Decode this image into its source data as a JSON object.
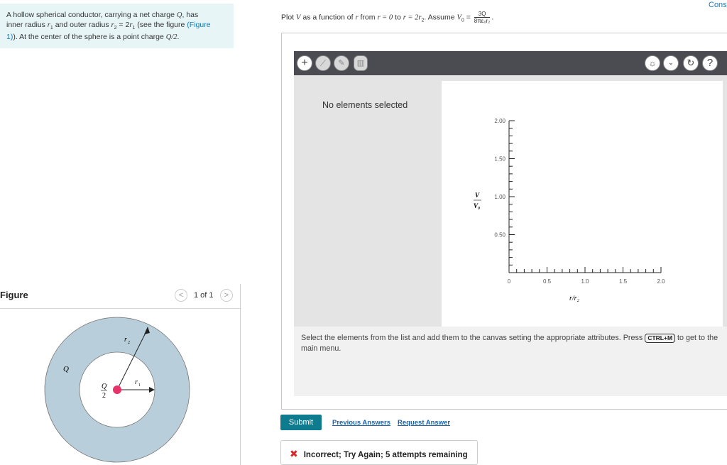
{
  "problem": {
    "line1a": "A hollow spherical conductor, carrying a net charge ",
    "line1_charge": "Q",
    "line1b": ", has",
    "line2a": "inner radius ",
    "line2_r1": "r",
    "line2b": " and outer radius ",
    "line2_r2": "r",
    "line2_eq": " = 2",
    "line2_r1b": "r",
    "line2c": " (see the figure ",
    "figure_link": "(Figure",
    "line3_link": "1)",
    "line3a": "). At the center of the sphere is a point charge ",
    "line3_charge": "Q/2",
    "line3b": "."
  },
  "figure": {
    "title": "Figure",
    "counter": "1 of 1",
    "label_Q": "Q",
    "label_r2": "r",
    "label_r2_sub": "2",
    "label_r1": "r",
    "label_r1_sub": "1",
    "label_q_num": "Q",
    "label_q_den": "2"
  },
  "question": {
    "prefix": "Plot ",
    "V": "V",
    "mid1": " as a function of ",
    "r": "r",
    "mid2": " from ",
    "range1": "r = 0",
    "to": " to ",
    "range2": "r = 2r",
    "range2_sub": "2",
    "assume": ". Assume ",
    "V0": "V",
    "V0_sub": "0",
    "eq": " = ",
    "frac_num": "3Q",
    "frac_den": "8πε₀r₂",
    "end": "."
  },
  "cons_link": "Cons",
  "toolbar": {
    "add_icon": "plus-icon",
    "line_icon": "line-tool-icon",
    "edit_icon": "edit-plus-icon",
    "delete_icon": "trash-icon",
    "hint_icon": "lightbulb-icon",
    "more_icon": "chevron-down-icon",
    "reset_icon": "reset-icon",
    "help_label": "?"
  },
  "elements_panel": {
    "empty": "No elements selected"
  },
  "instructions": {
    "text1": "Select the elements from the list and add them to the canvas setting the appropriate attributes. Press ",
    "kbd": "CTRL+M",
    "text2": " to get to the main menu."
  },
  "chart_data": {
    "type": "line",
    "xlabel": "r/r₂",
    "ylabel_num": "V",
    "ylabel_den": "V₀",
    "x_ticks": [
      "0",
      "0.5",
      "1.0",
      "1.5",
      "2.0"
    ],
    "x_tick_values": [
      0,
      0.5,
      1.0,
      1.5,
      2.0
    ],
    "y_ticks": [
      "0.50",
      "1.00",
      "1.50",
      "2.00"
    ],
    "y_tick_values": [
      0.5,
      1.0,
      1.5,
      2.0
    ],
    "xlim": [
      0,
      2
    ],
    "ylim": [
      0,
      2
    ],
    "series": []
  },
  "actions": {
    "submit": "Submit",
    "previous_answers": "Previous Answers",
    "request_answer": "Request Answer"
  },
  "feedback": {
    "icon": "✖",
    "text": "Incorrect; Try Again; 5 attempts remaining"
  }
}
